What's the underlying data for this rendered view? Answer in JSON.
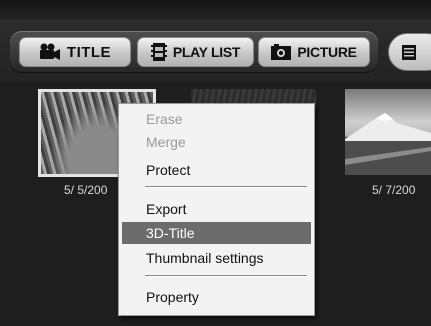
{
  "toolbar": {
    "tabs": [
      {
        "label": "TITLE",
        "icon": "movie-camera-icon"
      },
      {
        "label": "PLAY LIST",
        "icon": "film-strip-icon"
      },
      {
        "label": "PICTURE",
        "icon": "photo-camera-icon"
      }
    ],
    "view_button_icon": "list-view-icon"
  },
  "thumbnails": [
    {
      "date": "5/ 5/200"
    },
    {
      "date": ""
    },
    {
      "date": "5/ 7/200"
    }
  ],
  "context_menu": {
    "items": [
      {
        "label": "Erase",
        "enabled": false
      },
      {
        "label": "Merge",
        "enabled": false
      },
      {
        "label": "Protect",
        "enabled": true
      },
      {
        "label": "Export",
        "enabled": true
      },
      {
        "label": "3D-Title",
        "enabled": true,
        "highlighted": true
      },
      {
        "label": "Thumbnail settings",
        "enabled": true
      },
      {
        "label": "Property",
        "enabled": true
      }
    ]
  },
  "colors": {
    "background": "#1e1e1e",
    "menu_background": "#f3f3f3",
    "menu_highlight": "#6c6c6c",
    "disabled_text": "#9a9a9a"
  }
}
